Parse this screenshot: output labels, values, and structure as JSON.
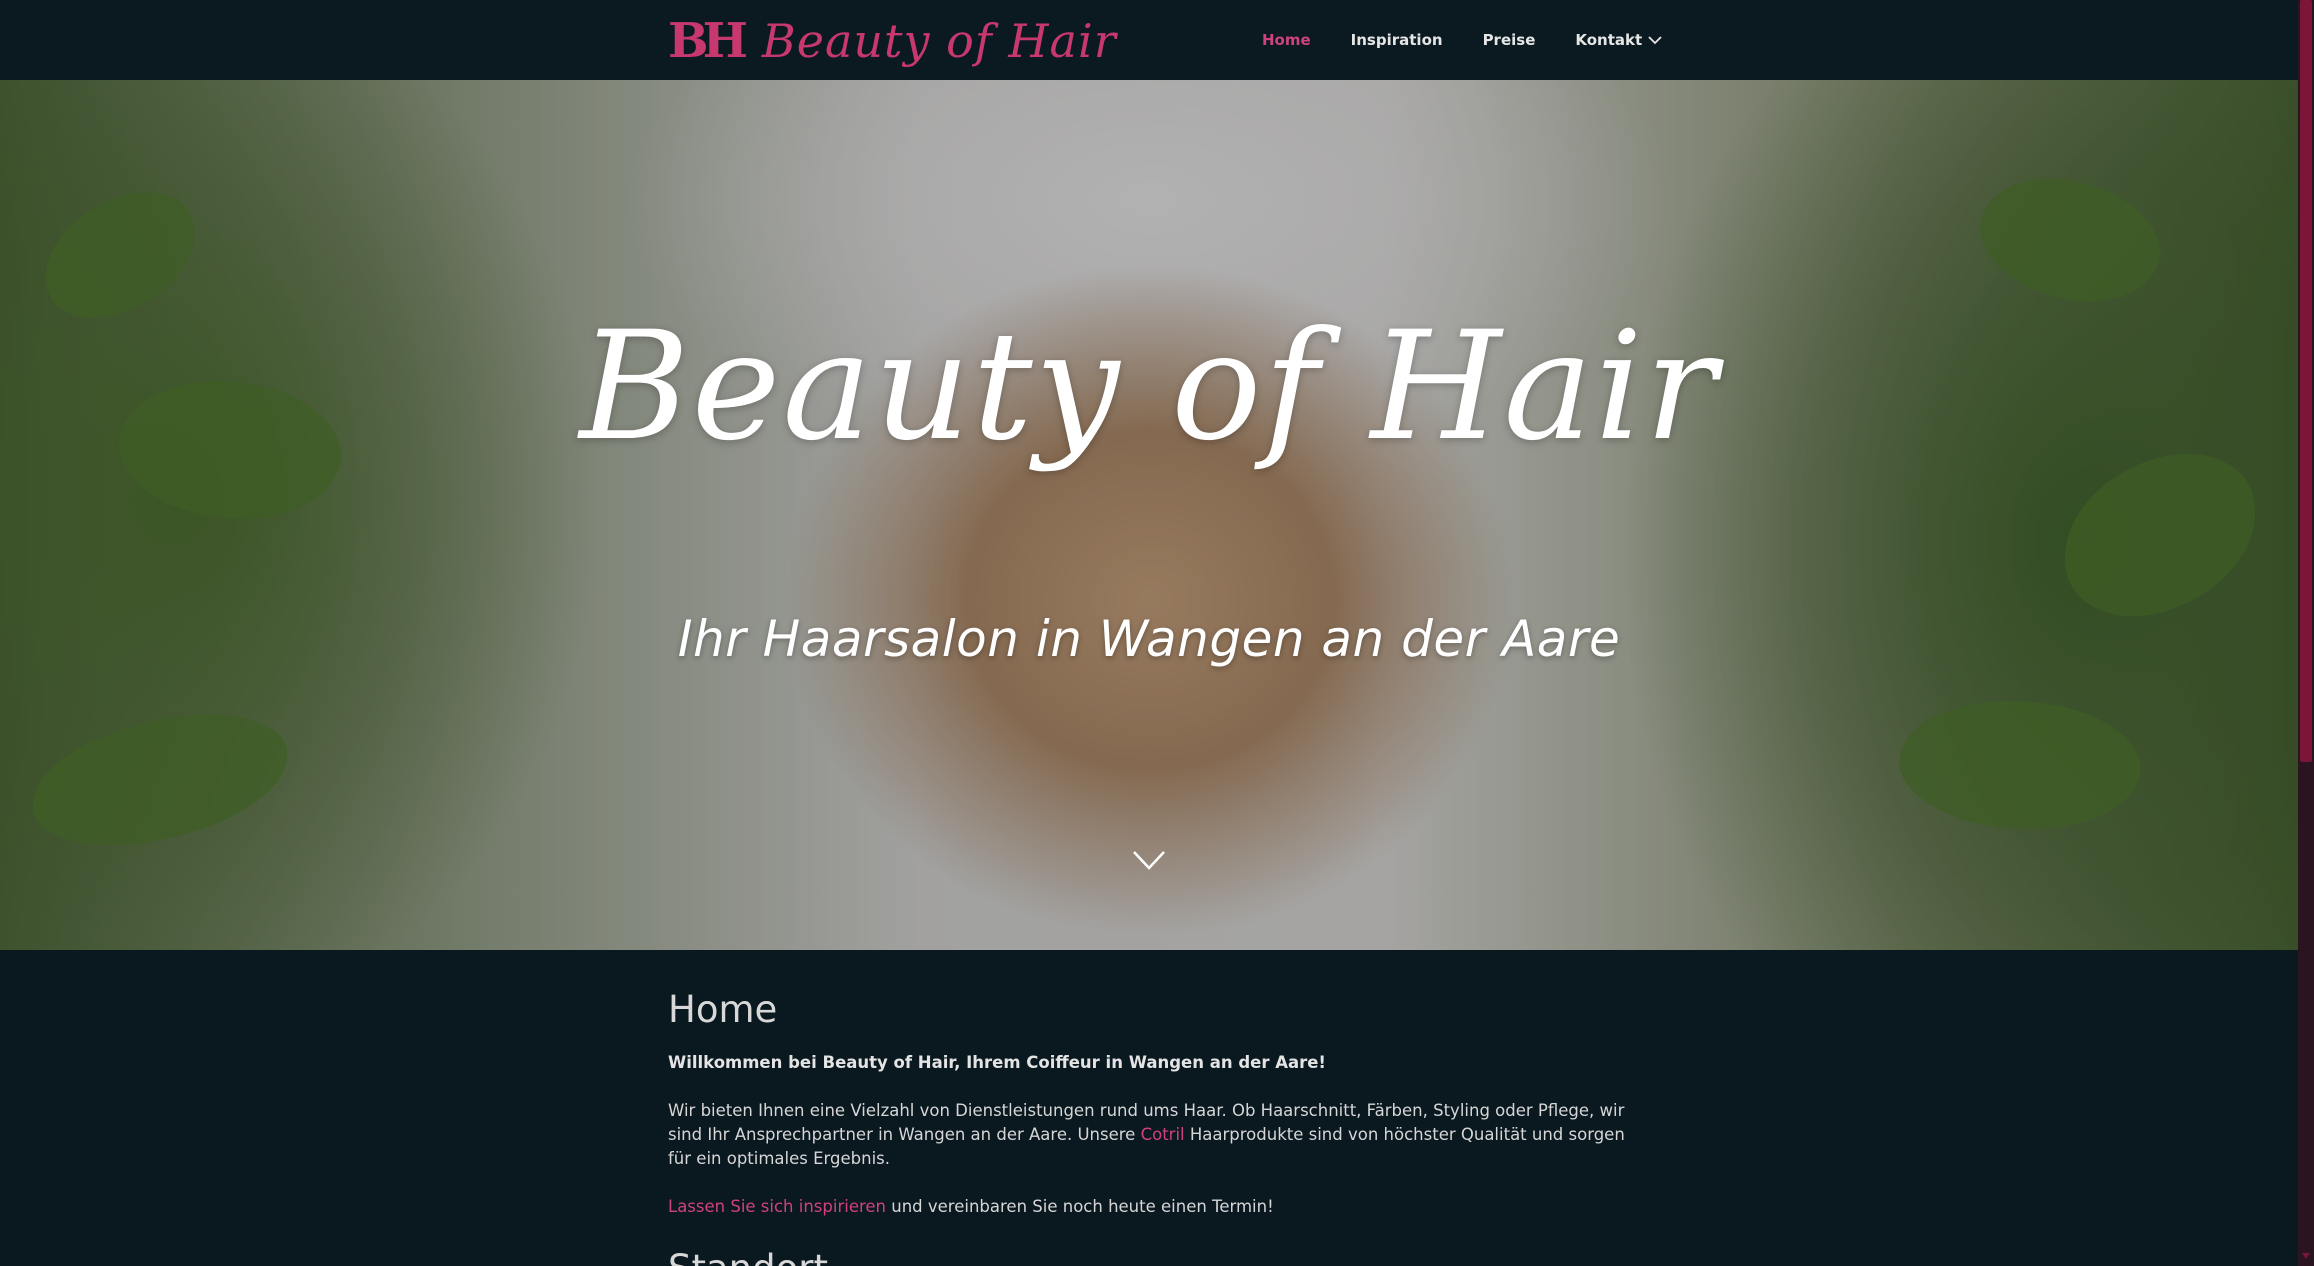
{
  "brand": {
    "monogram": "BH",
    "name": "Beauty of Hair",
    "accent_color": "#c7386e",
    "background_color": "#0a1820"
  },
  "nav": {
    "items": [
      {
        "label": "Home",
        "active": true
      },
      {
        "label": "Inspiration",
        "active": false
      },
      {
        "label": "Preise",
        "active": false
      },
      {
        "label": "Kontakt",
        "active": false,
        "has_dropdown": true
      }
    ]
  },
  "hero": {
    "title": "Beauty of Hair",
    "subtitle": "Ihr Haarsalon in Wangen an der Aare",
    "scroll_icon": "chevron-down-icon"
  },
  "content": {
    "heading": "Home",
    "lead": "Willkommen bei Beauty of Hair, Ihrem Coiffeur in Wangen an der Aare!",
    "paragraph1_part1": "Wir bieten Ihnen eine Vielzahl von Dienstleistungen rund ums Haar. Ob Haarschnitt, Färben, Styling oder Pflege, wir sind Ihr Ansprechpartner in Wangen an der Aare. Unsere ",
    "paragraph1_link": "Cotril",
    "paragraph1_part2": " Haarprodukte sind von höchster Qualität und sorgen für ein optimales Ergebnis.",
    "paragraph2_link": "Lassen Sie sich inspirieren",
    "paragraph2_rest": " und vereinbaren Sie noch heute einen Termin!",
    "next_heading": "Standort"
  }
}
